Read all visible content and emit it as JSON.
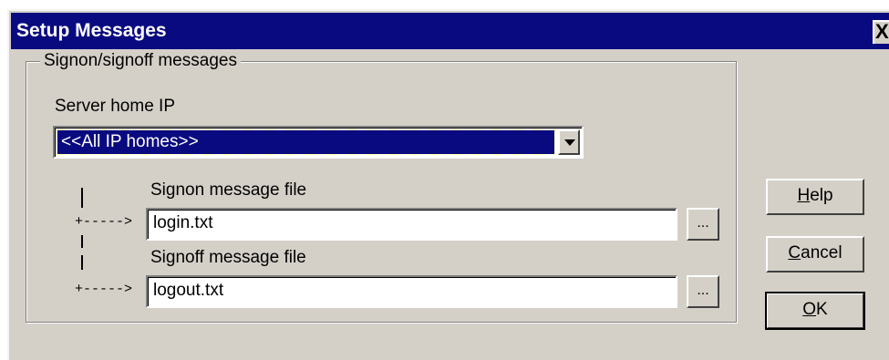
{
  "window": {
    "title": "Setup Messages",
    "close_glyph": "X"
  },
  "group": {
    "legend": "Signon/signoff messages",
    "server_label": "Server home IP",
    "server_combo": {
      "selected": "<<All IP homes>>"
    },
    "signon": {
      "label": "Signon message file",
      "value": "login.txt",
      "browse_label": "..."
    },
    "signoff": {
      "label": "Signoff message file",
      "value": "logout.txt",
      "browse_label": "..."
    },
    "connector_arrow": "+----->"
  },
  "buttons": {
    "help": {
      "accel": "H",
      "rest": "elp"
    },
    "cancel": {
      "accel": "C",
      "rest": "ancel"
    },
    "ok": {
      "accel": "O",
      "rest": "K"
    }
  },
  "colors": {
    "titlebar": "#0a0a80",
    "face": "#d4d0c8",
    "selection": "#0a0a80"
  }
}
